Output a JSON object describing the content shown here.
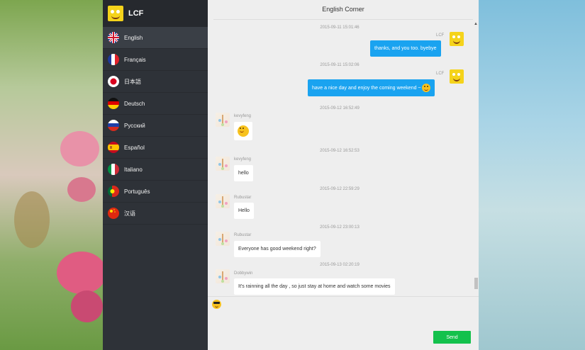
{
  "profile": {
    "name": "LCF"
  },
  "languages": [
    {
      "label": "English",
      "flag": "uk-flag-icon"
    },
    {
      "label": "Français",
      "flag": "france-flag-icon"
    },
    {
      "label": "日本語",
      "flag": "japan-flag-icon"
    },
    {
      "label": "Deutsch",
      "flag": "germany-flag-icon"
    },
    {
      "label": "Русский",
      "flag": "russia-flag-icon"
    },
    {
      "label": "Español",
      "flag": "spain-flag-icon"
    },
    {
      "label": "Italiano",
      "flag": "italy-flag-icon"
    },
    {
      "label": "Português",
      "flag": "portugal-flag-icon"
    },
    {
      "label": "汉语",
      "flag": "china-flag-icon"
    }
  ],
  "chat": {
    "title": "English Corner",
    "messages": [
      {
        "time": "2015-09-11 15:01:46",
        "user": "LCF",
        "text": "thanks, and you too. byebye"
      },
      {
        "time": "2015-09-11 15:02:06",
        "user": "LCF",
        "text": "have a nice day and enjoy the coming weekend ~"
      },
      {
        "time": "2015-09-12 16:52:49",
        "user": "kevyfeng",
        "text": ""
      },
      {
        "time": "2015-09-12 16:52:53",
        "user": "kevyfeng",
        "text": "hello"
      },
      {
        "time": "2015-09-12 22:59:29",
        "user": "Rubustar",
        "text": "Hello"
      },
      {
        "time": "2015-09-12 23:00:13",
        "user": "Rubustar",
        "text": "Everyone has good weekend right?"
      },
      {
        "time": "2015-09-13 02:20:19",
        "user": "Dobbywin",
        "text": "It's rainning all the day , so just stay at home and watch some movies"
      }
    ]
  },
  "input": {
    "send_label": "Send"
  },
  "colors": {
    "sidebar": "#2e3238",
    "my_bubble": "#1aa3f0",
    "send": "#13c14c"
  }
}
